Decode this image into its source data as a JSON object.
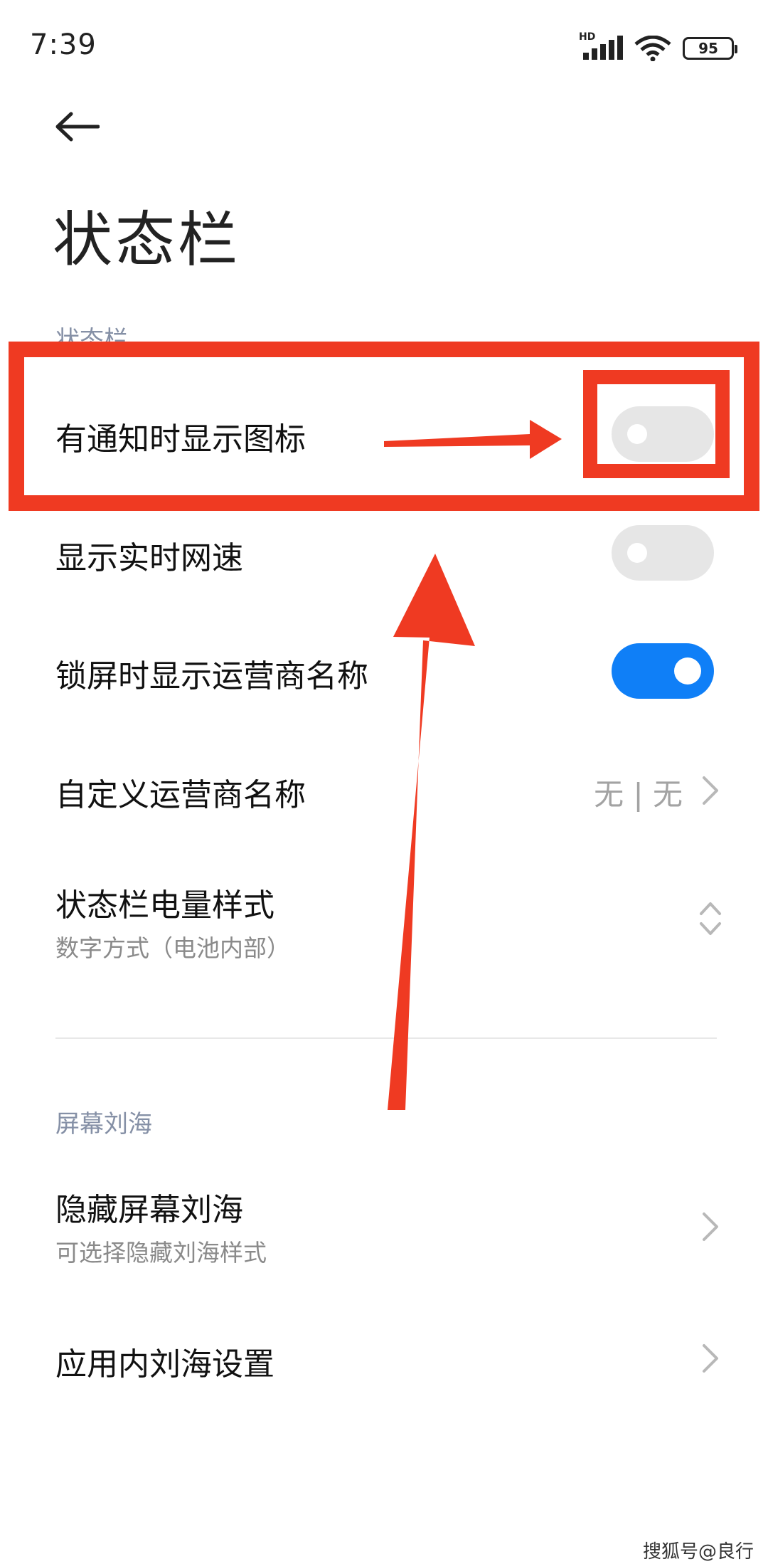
{
  "status_bar": {
    "time": "7:39",
    "network_badge": "HD",
    "battery_level": "95",
    "icons": [
      "signal-icon",
      "wifi-icon",
      "battery-icon"
    ]
  },
  "header": {
    "back_icon": "back-arrow-icon",
    "title": "状态栏"
  },
  "sections": [
    {
      "header": "状态栏",
      "items": [
        {
          "title": "有通知时显示图标",
          "control": "toggle",
          "state": "off"
        },
        {
          "title": "显示实时网速",
          "control": "toggle",
          "state": "off"
        },
        {
          "title": "锁屏时显示运营商名称",
          "control": "toggle",
          "state": "on"
        },
        {
          "title": "自定义运营商名称",
          "value": "无 | 无",
          "control": "chevron-right"
        },
        {
          "title": "状态栏电量样式",
          "subtitle": "数字方式（电池内部）",
          "control": "chevron-updown"
        }
      ]
    },
    {
      "header": "屏幕刘海",
      "items": [
        {
          "title": "隐藏屏幕刘海",
          "subtitle": "可选择隐藏刘海样式",
          "control": "chevron-right"
        },
        {
          "title": "应用内刘海设置",
          "control": "chevron-right"
        }
      ]
    }
  ],
  "watermark": "搜狐号@良行",
  "colors": {
    "toggle_on": "#0f7ff7",
    "toggle_off": "#e6e6e6",
    "annotation": "#ef3a22",
    "section_header": "#8590a6"
  }
}
